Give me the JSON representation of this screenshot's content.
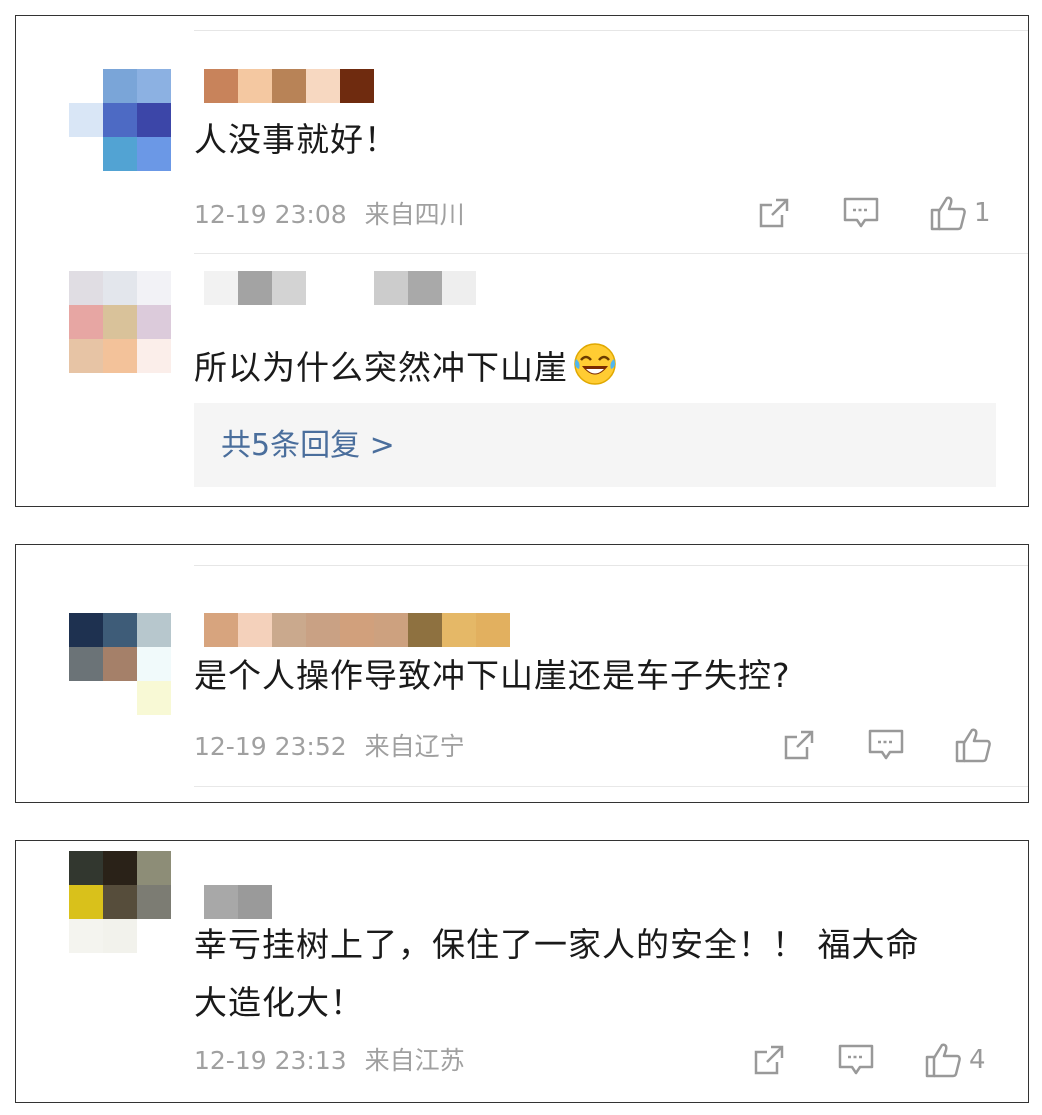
{
  "comments": [
    {
      "text": "人没事就好！",
      "date": "12-19 23:08",
      "location": "来自四川",
      "like_count": "1",
      "username_pixels": [
        "#c8835b",
        "#f4c8a1",
        "#b88357",
        "#f7d8c1",
        "#6f2b0f"
      ],
      "avatar_pixels": [
        "#ffffff",
        "#7aa5d8",
        "#8cb1e2",
        "#d9e6f6",
        "#4d6ac4",
        "#3c46a8",
        "#ffffff",
        "#52a3d3",
        "#6b98e6"
      ],
      "avatar_extra": [
        "#f7f9fc",
        "#e8eef8",
        "#2f3b80",
        "#de4a2a"
      ]
    },
    {
      "text": "所以为什么突然冲下山崖",
      "reply_label": "共5条回复 >",
      "username_pixels": [
        "#f2f2f2",
        "#a3a3a3",
        "#d3d3d3",
        "#ffffff",
        "#ffffff",
        "#cccccc",
        "#a9a9a9",
        "#eeeeee"
      ],
      "avatar_pixels": [
        "#e0dde3",
        "#e3e6ec",
        "#f2f2f6",
        "#e7a6a3",
        "#d9c29a",
        "#dccbdb",
        "#e7c4a5",
        "#f3c29a",
        "#fbeeea"
      ],
      "emoji_icon": "laughing-crying-emoji"
    },
    {
      "text": "是个人操作导致冲下山崖还是车子失控?",
      "date": "12-19 23:52",
      "location": "来自辽宁",
      "like_count": "",
      "username_pixels": [
        "#d7a47e",
        "#f4d1bb",
        "#caa98d",
        "#c9a184",
        "#d1a07c",
        "#cda17f",
        "#8e7140",
        "#e5b867",
        "#e2b05f"
      ],
      "avatar_pixels": [
        "#1e3150",
        "#3e5c78",
        "#b7c7cd",
        "#6b7377",
        "#a58069",
        "#f1fafb",
        "#ffffff",
        "#ffffff",
        "#f8f9d5"
      ]
    },
    {
      "text_line1": "幸亏挂树上了，保住了一家人的安全！！ 福大命",
      "text_line2": "大造化大！",
      "date": "12-19 23:13",
      "location": "来自江苏",
      "like_count": "4",
      "username_pixels": [
        "#a8a8a8",
        "#9a9a9a"
      ],
      "avatar_pixels": [
        "#32372f",
        "#2a2218",
        "#8d8d77",
        "#d9c11b",
        "#564d3b",
        "#7c7c73",
        "#f4f4ef",
        "#f2f2ec",
        "#ffffff"
      ]
    }
  ],
  "icons": {
    "share": "share-icon",
    "comment": "comment-icon",
    "like": "thumbs-up-icon"
  }
}
